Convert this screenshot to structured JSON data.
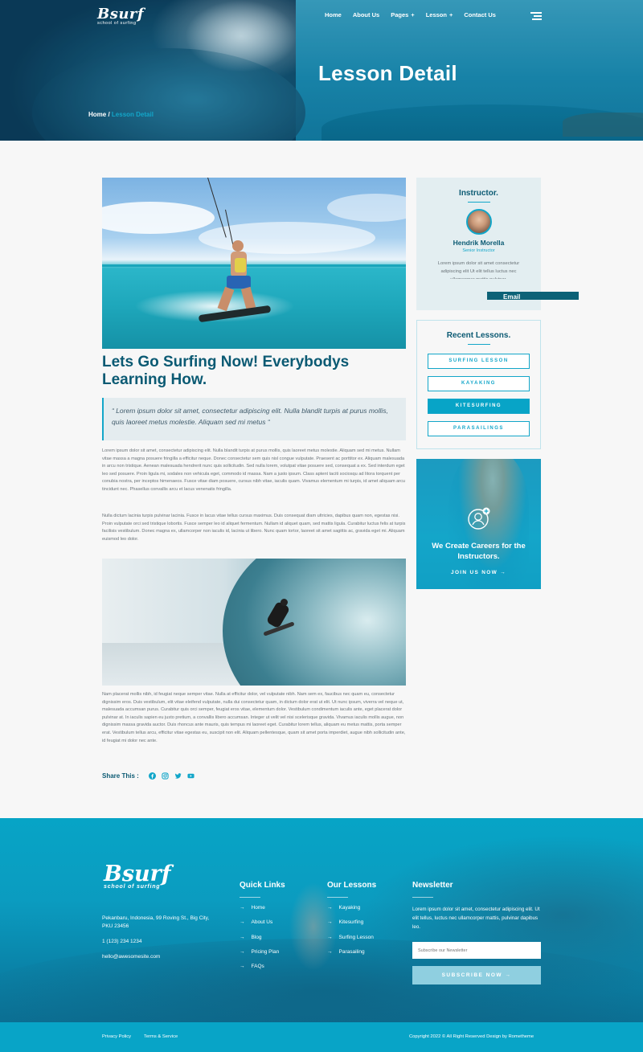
{
  "brand": {
    "name": "Bsurf",
    "tagline": "school of surfing"
  },
  "nav": {
    "items": [
      {
        "label": "Home",
        "has_submenu": false
      },
      {
        "label": "About Us",
        "has_submenu": false
      },
      {
        "label": "Pages",
        "has_submenu": true
      },
      {
        "label": "Lesson",
        "has_submenu": true
      },
      {
        "label": "Contact Us",
        "has_submenu": false
      }
    ],
    "submenu_symbol": "+"
  },
  "hero": {
    "title": "Lesson Detail",
    "breadcrumb": {
      "home": "Home",
      "separator": " / ",
      "current": "Lesson Detail"
    }
  },
  "post": {
    "title": "Lets Go Surfing Now! Everybodys Learning How.",
    "quote": "“ Lorem ipsum dolor sit amet, consectetur adipiscing elit. Nulla blandit turpis at purus mollis, quis laoreet metus molestie. Aliquam sed mi metus “",
    "paragraphs": [
      "Lorem ipsum dolor sit amet, consectetur adipiscing elit. Nulla blandit turpis at purus mollis, quis laoreet metus molestie. Aliquam sed mi metus. Nullam vitae massa a magna posuere fringilla a efficitur neque. Donec consectetur sem quis nisl congue vulputate. Praesent ac porttitor ex. Aliquam malesuada in arcu non tristique. Aenean malesuada hendrerit nunc quis sollicitudin. Sed nulla lorem, volutpat vitae posuere sed, consequat a ex. Sed interdum eget leo sed posuere. Proin ligula mi, sodales non vehicula eget, commodo id massa. Nam a justo ipsum. Class aptent taciti sociosqu ad litora torquent per conubia nostra, per inceptos himenaeos. Fusce vitae diam posuere, cursus nibh vitae, iaculis quam. Vivamus elementum mi turpis, id amet aliquam arcu tincidunt nec. Phasellus convallis arcu et lacus venenatis fringilla.",
      "Nulla dictum lacinia turpis pulvinar lacinia. Fusce in lacus vitae tellus cursus maximus. Duis consequat diam ultricies, dapibus quam non, egestas nisi. Proin vulputate orci sed tristique lobortis. Fusce semper leo id aliquet fermentum. Nullam id aliquet quam, sed mattis ligula. Curabitur luctus felis at turpis facilisis vestibulum. Donec magna ex, ullamcorper non iaculis id, lacinia ut libero. Nunc quam tortor, laoreet sit amet sagittis ac, gravida eget mi. Aliquam euismod leo dolor.",
      "Nam placerat mollis nibh, id feugiat neque semper vitae. Nulla at efficitur dolor, vel vulputate nibh. Nam sem ex, faucibus nec quam eu, consectetur dignissim eros. Duis vestibulum, elit vitae eleifend vulputate, nulla dui consectetur quam, in dictum dolor erat ut elit. Ut nunc ipsum, viverra vel neque ut, malesuada accumsan purus. Curabitur quis orci semper, feugiat eros vitae, elementum dolor. Vestibulum condimentum iaculis ante, eget placerat dolor pulvinar at. In iaculis sapien eu justo pretium, a convallis libero accumsan. Integer ut velit vel nisi scelerisque gravida. Vivamus iaculis mollis augue, non dignissim massa gravida auctor. Duis rhoncus ante mauris, quis tempus mi laoreet eget. Curabitur lorem tellus, aliquam eu metus mattis, porta semper erat. Vestibulum tellus arcu, efficitur vitae egestas eu, suscipit non elit. Aliquam pellentesque, quam sit amet porta imperdiet, augue nibh sollicitudin ante, id feugiat mi dolor nec ante."
    ],
    "share_label": "Share This :",
    "share_icons": [
      "facebook-icon",
      "instagram-icon",
      "twitter-icon",
      "youtube-icon"
    ]
  },
  "sidebar": {
    "instructor": {
      "heading": "Instructor.",
      "name": "Hendrik Morella",
      "role": "Senior Instructor",
      "bio": "Lorem ipsum dolor sit amet consectetur adipiscing elit Ut elit tellus luctus nec ullamcorper mattis pulvinar."
    },
    "email_tab": "Email",
    "recent": {
      "heading": "Recent Lessons.",
      "items": [
        {
          "label": "SURFING LESSON",
          "active": false
        },
        {
          "label": "KAYAKING",
          "active": false
        },
        {
          "label": "KITESURFING",
          "active": true
        },
        {
          "label": "PARASAILINGS",
          "active": false
        }
      ]
    },
    "promo": {
      "text": "We Create Careers for the Instructors.",
      "cta": "JOIN US NOW",
      "cta_arrow": "→"
    }
  },
  "footer": {
    "address": "Pekanbaru, Indonesia, 99 Roving St., Big City, PKU 23456",
    "phone": "1 (123) 234 1234",
    "email": "hello@awesomesite.com",
    "quick_links": {
      "heading": "Quick Links",
      "items": [
        "Home",
        "About Us",
        "Blog",
        "Pricing Plan",
        "FAQs"
      ]
    },
    "our_lessons": {
      "heading": "Our Lessons",
      "items": [
        "Kayaking",
        "Kitesurfing",
        "Surfing Lesson",
        "Parasailing"
      ]
    },
    "newsletter": {
      "heading": "Newsletter",
      "text": "Lorem ipsum dolor sit amet, consectetur adipiscing elit. Ut elit tellus, luctus nec ullamcorper mattis, pulvinar dapibus leo.",
      "placeholder": "Subscribe our Newsletter",
      "button": "SUBSCRIBE NOW",
      "button_arrow": "→"
    },
    "arrow": "→",
    "bottom": {
      "privacy": "Privacy Policy",
      "terms": "Terms & Service",
      "copyright": "Copyright 2022 © All Right Reserved Design by Rometheme"
    }
  },
  "colors": {
    "accent": "#08a4c7",
    "heading": "#0b5a73",
    "quote_bg": "#e4ecef"
  }
}
